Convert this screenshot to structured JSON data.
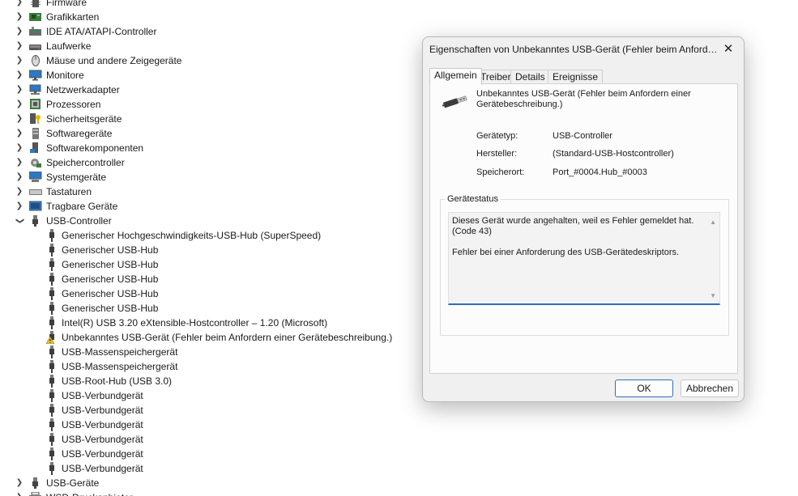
{
  "tree": {
    "categories_top": [
      {
        "label": "Firmware",
        "icon": "firmware-icon"
      },
      {
        "label": "Grafikkarten",
        "icon": "display-adapter-icon"
      },
      {
        "label": "IDE ATA/ATAPI-Controller",
        "icon": "ide-controller-icon"
      },
      {
        "label": "Laufwerke",
        "icon": "disk-drive-icon"
      },
      {
        "label": "Mäuse und andere Zeigegeräte",
        "icon": "mouse-icon"
      },
      {
        "label": "Monitore",
        "icon": "monitor-icon"
      },
      {
        "label": "Netzwerkadapter",
        "icon": "network-adapter-icon"
      },
      {
        "label": "Prozessoren",
        "icon": "processor-icon"
      },
      {
        "label": "Sicherheitsgeräte",
        "icon": "security-device-icon"
      },
      {
        "label": "Softwaregeräte",
        "icon": "software-device-icon"
      },
      {
        "label": "Softwarekomponenten",
        "icon": "software-component-icon"
      },
      {
        "label": "Speichercontroller",
        "icon": "storage-controller-icon"
      },
      {
        "label": "Systemgeräte",
        "icon": "system-device-icon"
      },
      {
        "label": "Tastaturen",
        "icon": "keyboard-icon"
      },
      {
        "label": "Tragbare Geräte",
        "icon": "portable-device-icon"
      }
    ],
    "usb_controller": {
      "label": "USB-Controller",
      "children": [
        "Generischer Hochgeschwindigkeits-USB-Hub (SuperSpeed)",
        "Generischer USB-Hub",
        "Generischer USB-Hub",
        "Generischer USB-Hub",
        "Generischer USB-Hub",
        "Generischer USB-Hub",
        "Intel(R) USB 3.20 eXtensible-Hostcontroller – 1.20 (Microsoft)",
        "Unbekanntes USB-Gerät (Fehler beim Anfordern einer Gerätebeschreibung.)",
        "USB-Massenspeichergerät",
        "USB-Massenspeichergerät",
        "USB-Root-Hub (USB 3.0)",
        "USB-Verbundgerät",
        "USB-Verbundgerät",
        "USB-Verbundgerät",
        "USB-Verbundgerät",
        "USB-Verbundgerät",
        "USB-Verbundgerät"
      ],
      "warning_index": 7
    },
    "categories_bottom": [
      {
        "label": "USB-Geräte",
        "icon": "usb-device-icon"
      },
      {
        "label": "WSD-Druckanbieter",
        "icon": "printer-icon"
      }
    ]
  },
  "dialog": {
    "title": "Eigenschaften von Unbekanntes USB-Gerät (Fehler beim Anforder...",
    "close_glyph": "✕",
    "tabs": [
      "Allgemein",
      "Treiber",
      "Details",
      "Ereignisse"
    ],
    "device_name": "Unbekanntes USB-Gerät (Fehler beim Anfordern einer Gerätebeschreibung.)",
    "props": [
      {
        "label": "Gerätetyp:",
        "value": "USB-Controller"
      },
      {
        "label": "Hersteller:",
        "value": "(Standard-USB-Hostcontroller)"
      },
      {
        "label": "Speicherort:",
        "value": "Port_#0004.Hub_#0003"
      }
    ],
    "status_group_label": "Gerätestatus",
    "status_line1": "Dieses Gerät wurde angehalten, weil es Fehler gemeldet hat.",
    "status_line2": "(Code 43)",
    "status_line3": "Fehler bei einer Anforderung des USB-Gerätedeskriptors.",
    "ok_label": "OK",
    "cancel_label": "Abbrechen"
  },
  "colors": {
    "accent": "#2d6fb4",
    "warning": "#f2c12e",
    "dialog_bg": "#f0f0f0"
  }
}
